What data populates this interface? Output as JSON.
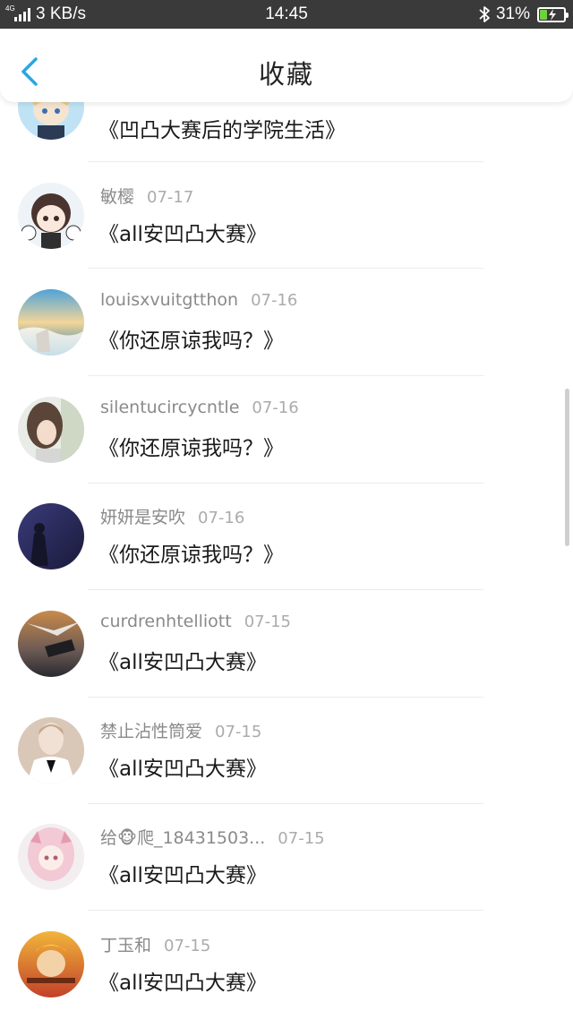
{
  "status_bar": {
    "network_type": "4G",
    "net_speed": "3 KB/s",
    "time": "14:45",
    "battery": "31%",
    "battery_level": 0.31
  },
  "header": {
    "title": "收藏"
  },
  "colors": {
    "accent": "#2aa6e0",
    "status_bar_bg": "#3a3a3a",
    "battery_fill": "#6dd13d"
  },
  "favorites": [
    {
      "author": "",
      "date": "",
      "title": "《凹凸大赛后的学院生活》"
    },
    {
      "author": "敏樱",
      "date": "07-17",
      "title": "《all安凹凸大赛》"
    },
    {
      "author": "louisxvuitgtthon",
      "date": "07-16",
      "title": "《你还原谅我吗？》"
    },
    {
      "author": "silentucircycntle",
      "date": "07-16",
      "title": "《你还原谅我吗？》"
    },
    {
      "author": "妍妍是安吹",
      "date": "07-16",
      "title": "《你还原谅我吗？》"
    },
    {
      "author": "curdrenhtelliott",
      "date": "07-15",
      "title": "《all安凹凸大赛》"
    },
    {
      "author": "禁止沾性筒爱",
      "date": "07-15",
      "title": "《all安凹凸大赛》"
    },
    {
      "author": "给🐵爬_18431503...",
      "date": "07-15",
      "title": "《all安凹凸大赛》"
    },
    {
      "author": "丁玉和",
      "date": "07-15",
      "title": "《all安凹凸大赛》"
    }
  ]
}
